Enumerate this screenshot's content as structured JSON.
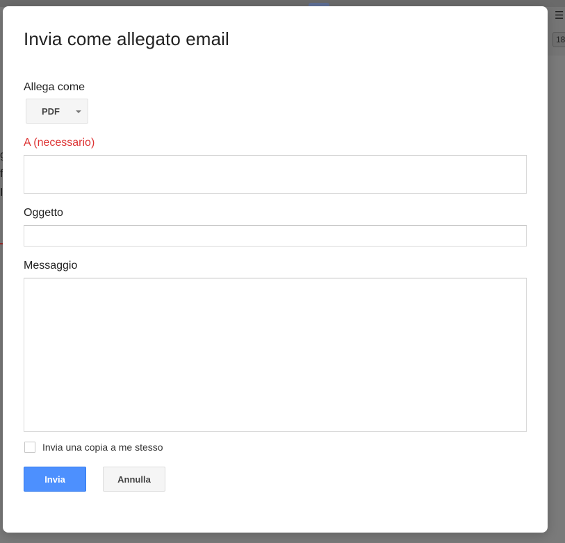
{
  "background": {
    "right_box_text": "18"
  },
  "dialog": {
    "title": "Invia come allegato email",
    "attach_as": {
      "label": "Allega come",
      "selected": "PDF"
    },
    "to": {
      "label": "A",
      "required_note": "(necessario)",
      "value": ""
    },
    "subject": {
      "label": "Oggetto",
      "value": ""
    },
    "message": {
      "label": "Messaggio",
      "value": ""
    },
    "send_copy": {
      "label": "Invia una copia a me stesso",
      "checked": false
    },
    "buttons": {
      "send": "Invia",
      "cancel": "Annulla"
    }
  },
  "colors": {
    "primary_button": "#4d90fe",
    "required_text": "#dd3333",
    "overlay": "#6e6e6e"
  }
}
